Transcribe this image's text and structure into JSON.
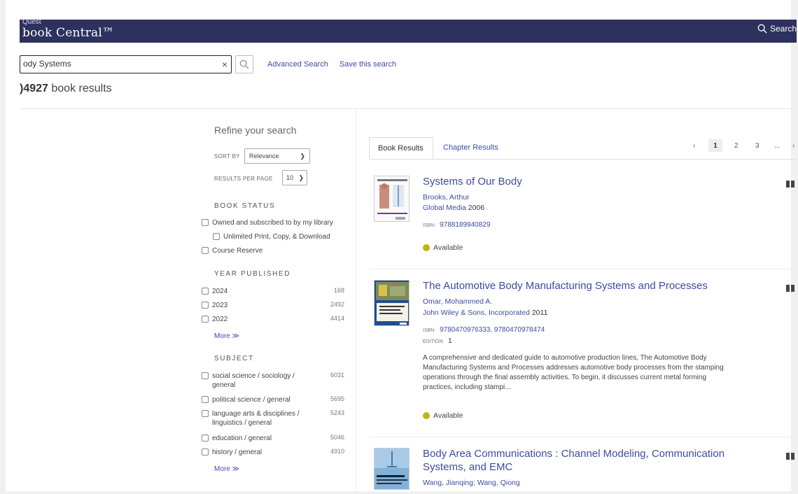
{
  "header": {
    "brand_small": "Quest",
    "brand": "book Central™",
    "search_label": "Search"
  },
  "search": {
    "value": "ody Systems",
    "clear": "×",
    "advanced": "Advanced Search",
    "save": "Save this search"
  },
  "results": {
    "count": ")4927",
    "count_label": "book results"
  },
  "sidebar": {
    "refine": "Refine your search",
    "sort_label": "SORT BY",
    "sort_value": "Relevance",
    "rpp_label": "RESULTS PER PAGE",
    "rpp_value": "10",
    "book_status": {
      "heading": "BOOK STATUS",
      "items": [
        "Owned and subscribed to by my library",
        "Unlimited Print, Copy, & Download",
        "Course Reserve"
      ]
    },
    "year": {
      "heading": "YEAR PUBLISHED",
      "items": [
        {
          "label": "2024",
          "count": "168"
        },
        {
          "label": "2023",
          "count": "2492"
        },
        {
          "label": "2022",
          "count": "4414"
        }
      ],
      "more": "More ≫"
    },
    "subject": {
      "heading": "SUBJECT",
      "items": [
        {
          "label": "social science / sociology / general",
          "count": "6031"
        },
        {
          "label": "political science / general",
          "count": "5695"
        },
        {
          "label": "language arts & disciplines / linguistics / general",
          "count": "5243"
        },
        {
          "label": "education / general",
          "count": "5046"
        },
        {
          "label": "history / general",
          "count": "4910"
        }
      ],
      "more": "More ≫"
    }
  },
  "tabs": {
    "book": "Book Results",
    "chapter": "Chapter Results"
  },
  "pager": {
    "prev": "‹",
    "p1": "1",
    "p2": "2",
    "p3": "3",
    "ellipsis": "...",
    "next": "›"
  },
  "books": [
    {
      "title": "Systems of Our Body",
      "author": "Brooks, Arthur",
      "publisher": "Global Media",
      "year": "2006",
      "isbn_label": "ISBN:",
      "isbn": "9788189940829",
      "status": "Available"
    },
    {
      "title": "The Automotive Body Manufacturing Systems and Processes",
      "author": "Omar, Mohammed A.",
      "publisher": "John Wiley & Sons, Incorporated",
      "year": "2011",
      "isbn_label": "ISBN:",
      "isbn": "9780470976333, 9780470978474",
      "edition_label": "EDITION:",
      "edition": "1",
      "description": "A comprehensive and dedicated guide to automotive production lines, The Automotive Body Manufacturing Systems and Processes addresses automotive body processes from the stamping operations through the final assembly activities. To begin, it discusses current metal forming practices, including stampi...",
      "status": "Available"
    },
    {
      "title_line1": "Body Area Communications : Channel Modeling, Communication",
      "title_line2": "Systems, and EMC",
      "author": "Wang, Jianqing; Wang, Qiong"
    }
  ],
  "colors": {
    "header_bg": "#2e315e",
    "link": "#3f4aa6",
    "available": "#c0b413"
  }
}
